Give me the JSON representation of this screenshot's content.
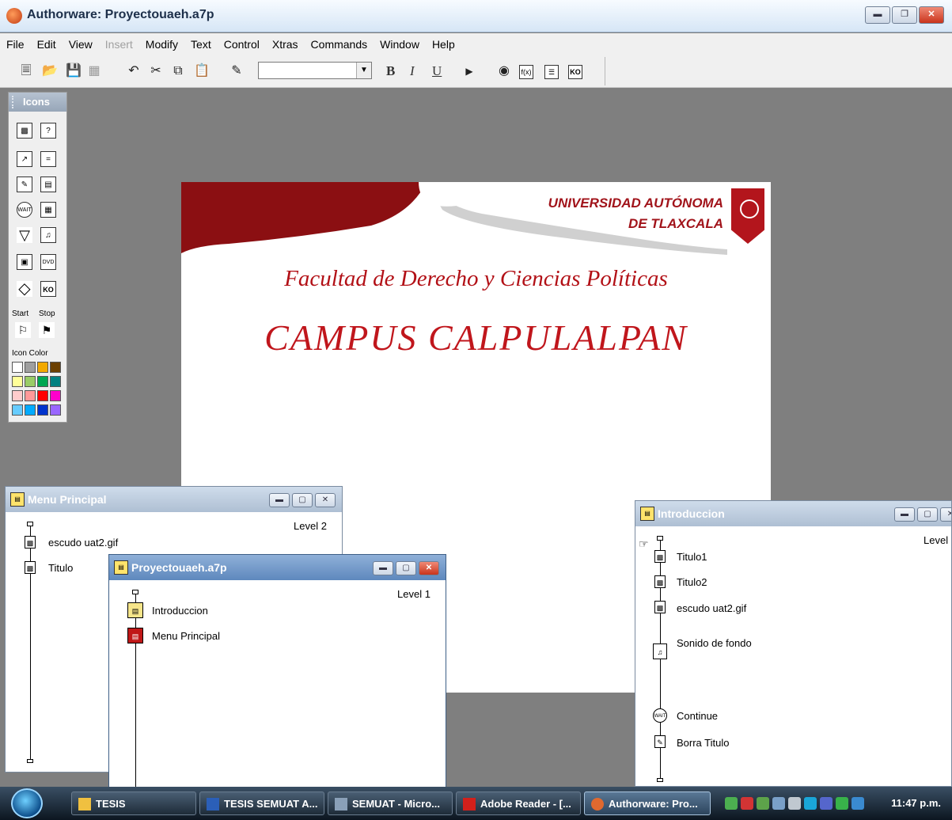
{
  "window": {
    "title": "Authorware: Proyectouaeh.a7p"
  },
  "menu": [
    {
      "label": "File",
      "enabled": true
    },
    {
      "label": "Edit",
      "enabled": true
    },
    {
      "label": "View",
      "enabled": true
    },
    {
      "label": "Insert",
      "enabled": false
    },
    {
      "label": "Modify",
      "enabled": true
    },
    {
      "label": "Text",
      "enabled": true
    },
    {
      "label": "Control",
      "enabled": true
    },
    {
      "label": "Xtras",
      "enabled": true
    },
    {
      "label": "Commands",
      "enabled": true
    },
    {
      "label": "Window",
      "enabled": true
    },
    {
      "label": "Help",
      "enabled": true
    }
  ],
  "toolbar": {
    "font_value": "",
    "bold": "B",
    "italic": "I",
    "underline": "U",
    "fx": "f(x)",
    "ko": "KO"
  },
  "palette": {
    "title": "Icons",
    "start_label": "Start",
    "stop_label": "Stop",
    "color_label": "Icon Color",
    "wait_text": "WAIT",
    "dvd_text": "DVD",
    "ko_text": "KO",
    "colors": [
      "#ffffff",
      "#9f9f9f",
      "#f2a900",
      "#6b3f00",
      "#ffff99",
      "#99cc66",
      "#00a651",
      "#008080",
      "#ffcccc",
      "#ff9999",
      "#ff0000",
      "#ff00cc",
      "#66ccff",
      "#00aaff",
      "#0033cc",
      "#9966ff"
    ]
  },
  "stage": {
    "university_line1": "UNIVERSIDAD AUTÓNOMA",
    "university_line2": "DE TLAXCALA",
    "faculty": "Facultad de Derecho y Ciencias Políticas",
    "campus": "CAMPUS CALPULALPAN",
    "brand_red": "#a1131a"
  },
  "windows": {
    "menu_principal": {
      "title": "Menu Principal",
      "level": "Level 2",
      "items": [
        "escudo uat2.gif",
        "Titulo"
      ]
    },
    "proyecto": {
      "title": "Proyectouaeh.a7p",
      "level": "Level 1",
      "items": [
        "Introduccion",
        "Menu Principal"
      ]
    },
    "introduccion": {
      "title": "Introduccion",
      "level": "Level",
      "items": [
        "Titulo1",
        "Titulo2",
        "escudo uat2.gif",
        "Sonido de fondo",
        "Continue",
        "Borra Titulo"
      ]
    }
  },
  "taskbar": {
    "tasks": [
      "TESIS",
      "TESIS SEMUAT A...",
      "SEMUAT - Micro...",
      "Adobe Reader - [...",
      "Authorware: Pro..."
    ],
    "active_task": "Authorware: Pro...",
    "clock": "11:47 p.m."
  }
}
